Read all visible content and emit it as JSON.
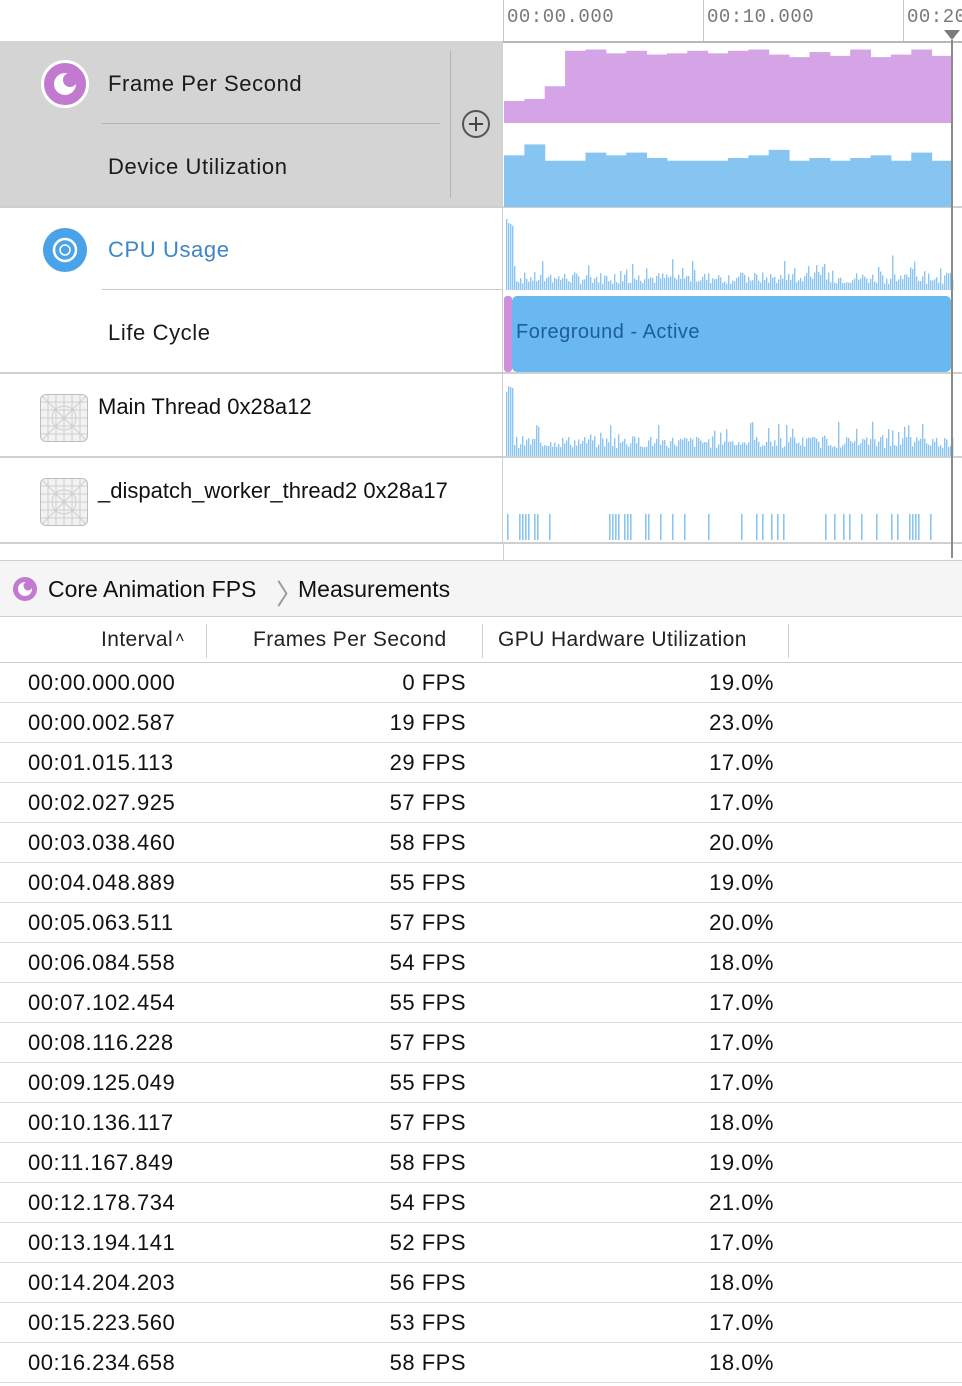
{
  "ruler": {
    "labels": [
      "00:00.000",
      "00:10.000",
      "00:20"
    ]
  },
  "tracks": {
    "core_animation": {
      "sub1": "Frame Per Second",
      "sub2": "Device Utilization"
    },
    "cpu": {
      "sub1": "CPU Usage",
      "sub2": "Life Cycle",
      "lifecycle_label": "Foreground - Active"
    },
    "threads": [
      {
        "name": "Main Thread  0x28a12"
      },
      {
        "name": "_dispatch_worker_thread2  0x28a17"
      }
    ]
  },
  "breadcrumb": {
    "instrument": "Core Animation FPS",
    "detail": "Measurements"
  },
  "table": {
    "columns": [
      "Interval",
      "Frames Per Second",
      "GPU Hardware Utilization"
    ],
    "rows": [
      [
        "00:00.000.000",
        "0 FPS",
        "19.0%"
      ],
      [
        "00:00.002.587",
        "19 FPS",
        "23.0%"
      ],
      [
        "00:01.015.113",
        "29 FPS",
        "17.0%"
      ],
      [
        "00:02.027.925",
        "57 FPS",
        "17.0%"
      ],
      [
        "00:03.038.460",
        "58 FPS",
        "20.0%"
      ],
      [
        "00:04.048.889",
        "55 FPS",
        "19.0%"
      ],
      [
        "00:05.063.511",
        "57 FPS",
        "20.0%"
      ],
      [
        "00:06.084.558",
        "54 FPS",
        "18.0%"
      ],
      [
        "00:07.102.454",
        "55 FPS",
        "17.0%"
      ],
      [
        "00:08.116.228",
        "57 FPS",
        "17.0%"
      ],
      [
        "00:09.125.049",
        "55 FPS",
        "17.0%"
      ],
      [
        "00:10.136.117",
        "57 FPS",
        "18.0%"
      ],
      [
        "00:11.167.849",
        "58 FPS",
        "19.0%"
      ],
      [
        "00:12.178.734",
        "54 FPS",
        "21.0%"
      ],
      [
        "00:13.194.141",
        "52 FPS",
        "17.0%"
      ],
      [
        "00:14.204.203",
        "56 FPS",
        "18.0%"
      ],
      [
        "00:15.223.560",
        "53 FPS",
        "17.0%"
      ],
      [
        "00:16.234.658",
        "58 FPS",
        "18.0%"
      ]
    ]
  },
  "colors": {
    "fps_graph": "#d4a4e6",
    "utilization_graph": "#86c4f2",
    "cpu_graph": "#8cc6f0",
    "accent_purple": "#c17ad0",
    "accent_blue": "#4aa3e8",
    "lifecycle": "#6ab8f2",
    "selected_track_bg": "#d4d4d4"
  }
}
